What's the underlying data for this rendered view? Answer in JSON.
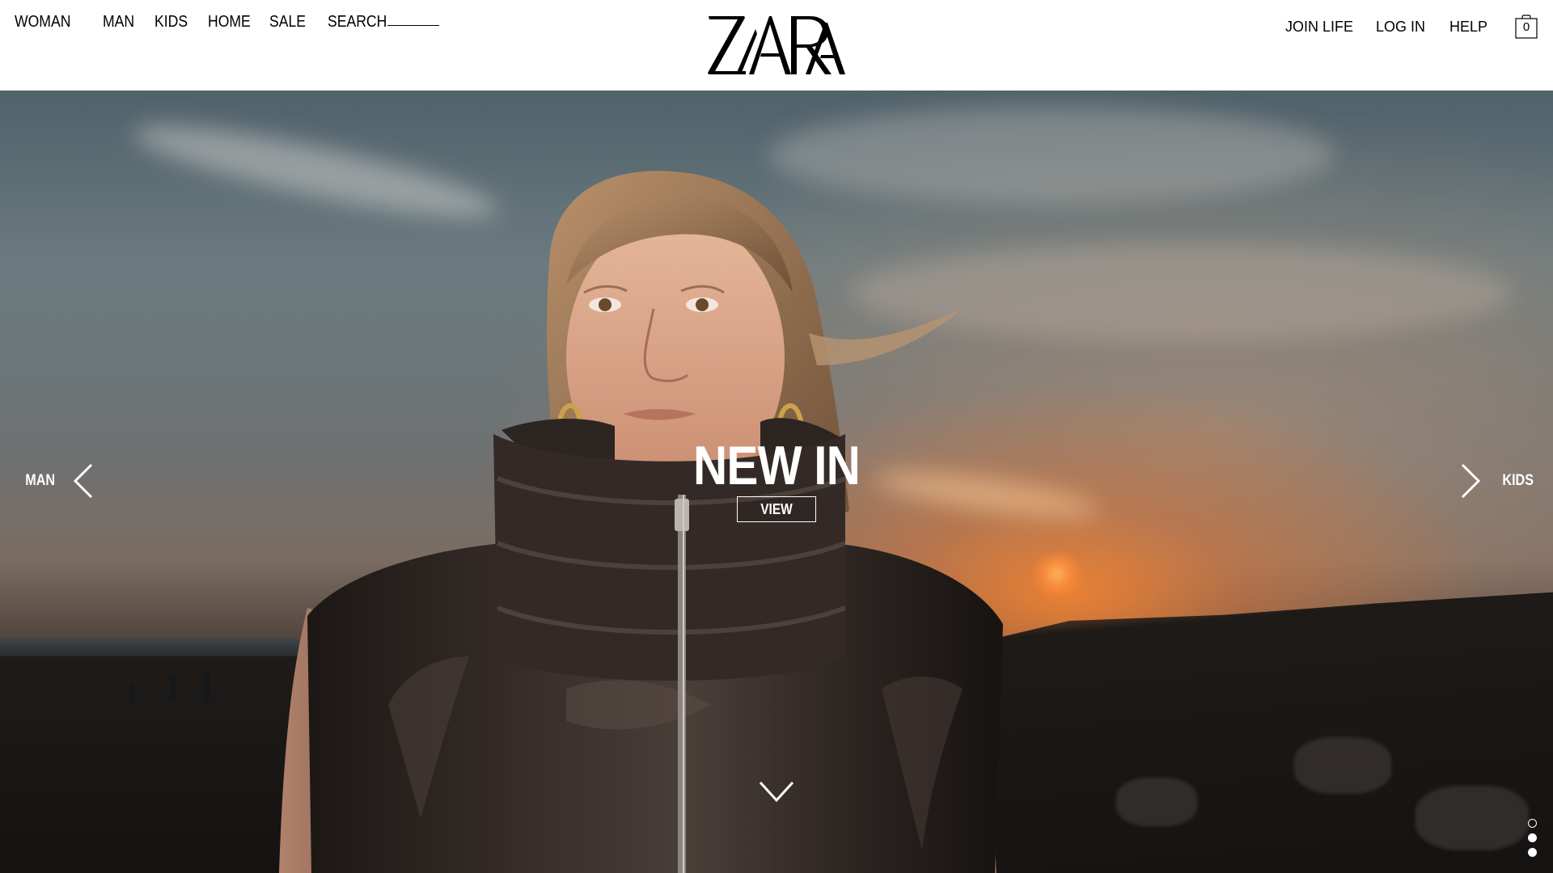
{
  "header": {
    "nav_left": [
      "WOMAN",
      "MAN",
      "KIDS",
      "HOME",
      "SALE"
    ],
    "search_label": "SEARCH",
    "logo_text": "ZARA",
    "nav_right": {
      "join_life": "JOIN LIFE",
      "log_in": "LOG IN",
      "help": "HELP"
    },
    "bag_count": "0"
  },
  "hero": {
    "headline": "NEW IN",
    "cta_label": "VIEW",
    "prev_label": "MAN",
    "next_label": "KIDS",
    "slides_total": 3,
    "active_slide_index": 0
  },
  "icons": [
    "chevron-left-icon",
    "chevron-right-icon",
    "chevron-down-icon",
    "shopping-bag-icon"
  ],
  "colors": {
    "header_bg": "#ffffff",
    "text_dark": "#000000",
    "overlay_text": "#ffffff"
  }
}
